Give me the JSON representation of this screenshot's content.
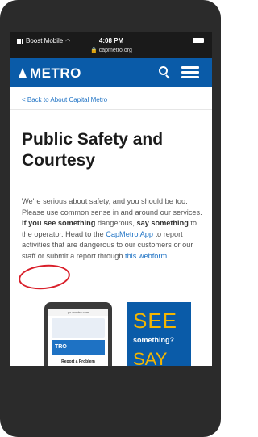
{
  "status_bar": {
    "carrier": "Boost Mobile",
    "time": "4:08 PM",
    "url": "capmetro.org"
  },
  "navbar": {
    "logo_text": "METRO"
  },
  "breadcrumb": "< Back to About Capital Metro",
  "page_title": "Public Safety and Courtesy",
  "body": {
    "t1": "We're serious about safety, and you should be too. Please use common sense in and around our services. ",
    "b1": "If you see something",
    "t2": " dangerous, ",
    "b2": "say something",
    "t3": " to the operator. Head to the ",
    "link1": "CapMetro App",
    "t4": " to report activities that are dangerous to our customers or our staff or submit a report through ",
    "link2": "this webform",
    "t5": "."
  },
  "promo": {
    "phone_url": "go.cmetro.com",
    "phone_banner": "TRO",
    "phone_report": "Report a Problem",
    "see": "SEE",
    "something": "something?",
    "say": "SAY"
  },
  "colors": {
    "nav_blue": "#0a5ba8",
    "link_blue": "#1e72c4",
    "highlight_red": "#d91f2a",
    "accent_yellow": "#f4b600"
  }
}
